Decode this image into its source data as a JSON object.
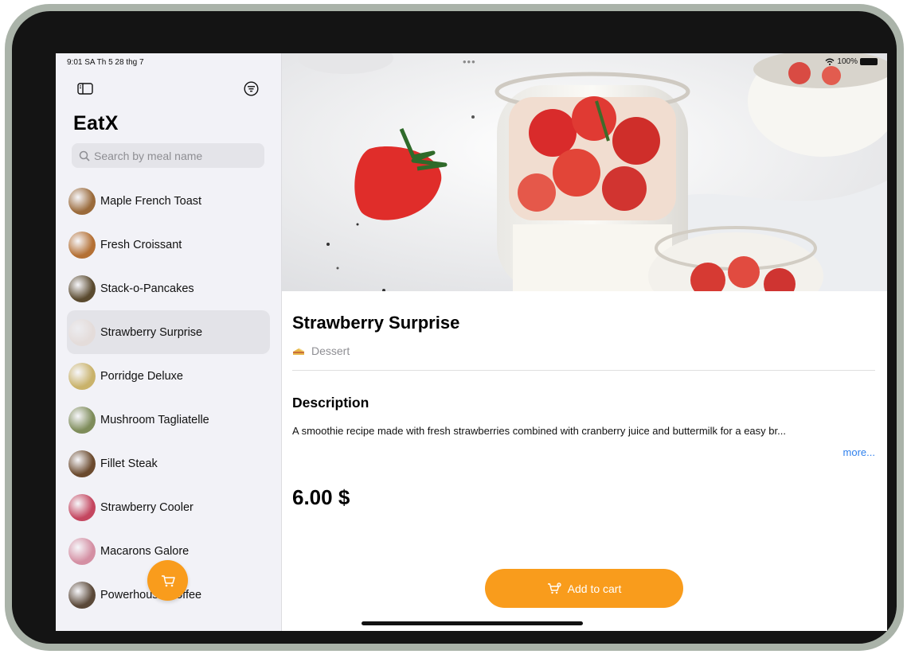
{
  "status_bar": {
    "time_date": "9:01 SA  Th 5 28 thg 7",
    "battery": "100%"
  },
  "sidebar": {
    "app_title": "EatX",
    "search_placeholder": "Search by meal name",
    "meals": [
      {
        "name": "Maple French Toast",
        "color": "#9a6a3a",
        "selected": false
      },
      {
        "name": "Fresh Croissant",
        "color": "#b47034",
        "selected": false
      },
      {
        "name": "Stack-o-Pancakes",
        "color": "#5a4a2f",
        "selected": false
      },
      {
        "name": "Strawberry Surprise",
        "color": "#e4dcda",
        "selected": true
      },
      {
        "name": "Porridge Deluxe",
        "color": "#c9b26a",
        "selected": false
      },
      {
        "name": "Mushroom Tagliatelle",
        "color": "#7e8c5a",
        "selected": false
      },
      {
        "name": "Fillet Steak",
        "color": "#6b4a2e",
        "selected": false
      },
      {
        "name": "Strawberry Cooler",
        "color": "#c4465f",
        "selected": false
      },
      {
        "name": "Macarons Galore",
        "color": "#d48fa3",
        "selected": false
      },
      {
        "name": "Powerhouse Coffee",
        "color": "#5a4838",
        "selected": false
      }
    ]
  },
  "detail": {
    "title": "Strawberry Surprise",
    "category": "Dessert",
    "description_heading": "Description",
    "description": "A smoothie recipe made with fresh strawberries combined with cranberry juice and buttermilk for a easy br...",
    "more_label": "more...",
    "price": "6.00 $",
    "add_to_cart_label": "Add to cart"
  },
  "colors": {
    "accent": "#f99c1c",
    "link": "#2f80ed",
    "sidebar_bg": "#f2f2f7",
    "selected_row": "#e3e3e8"
  },
  "icons": {
    "sidebar_toggle": "sidebar-toggle-icon",
    "filter": "filter-icon",
    "search": "search-icon",
    "cart": "cart-icon",
    "category": "cake-icon"
  }
}
